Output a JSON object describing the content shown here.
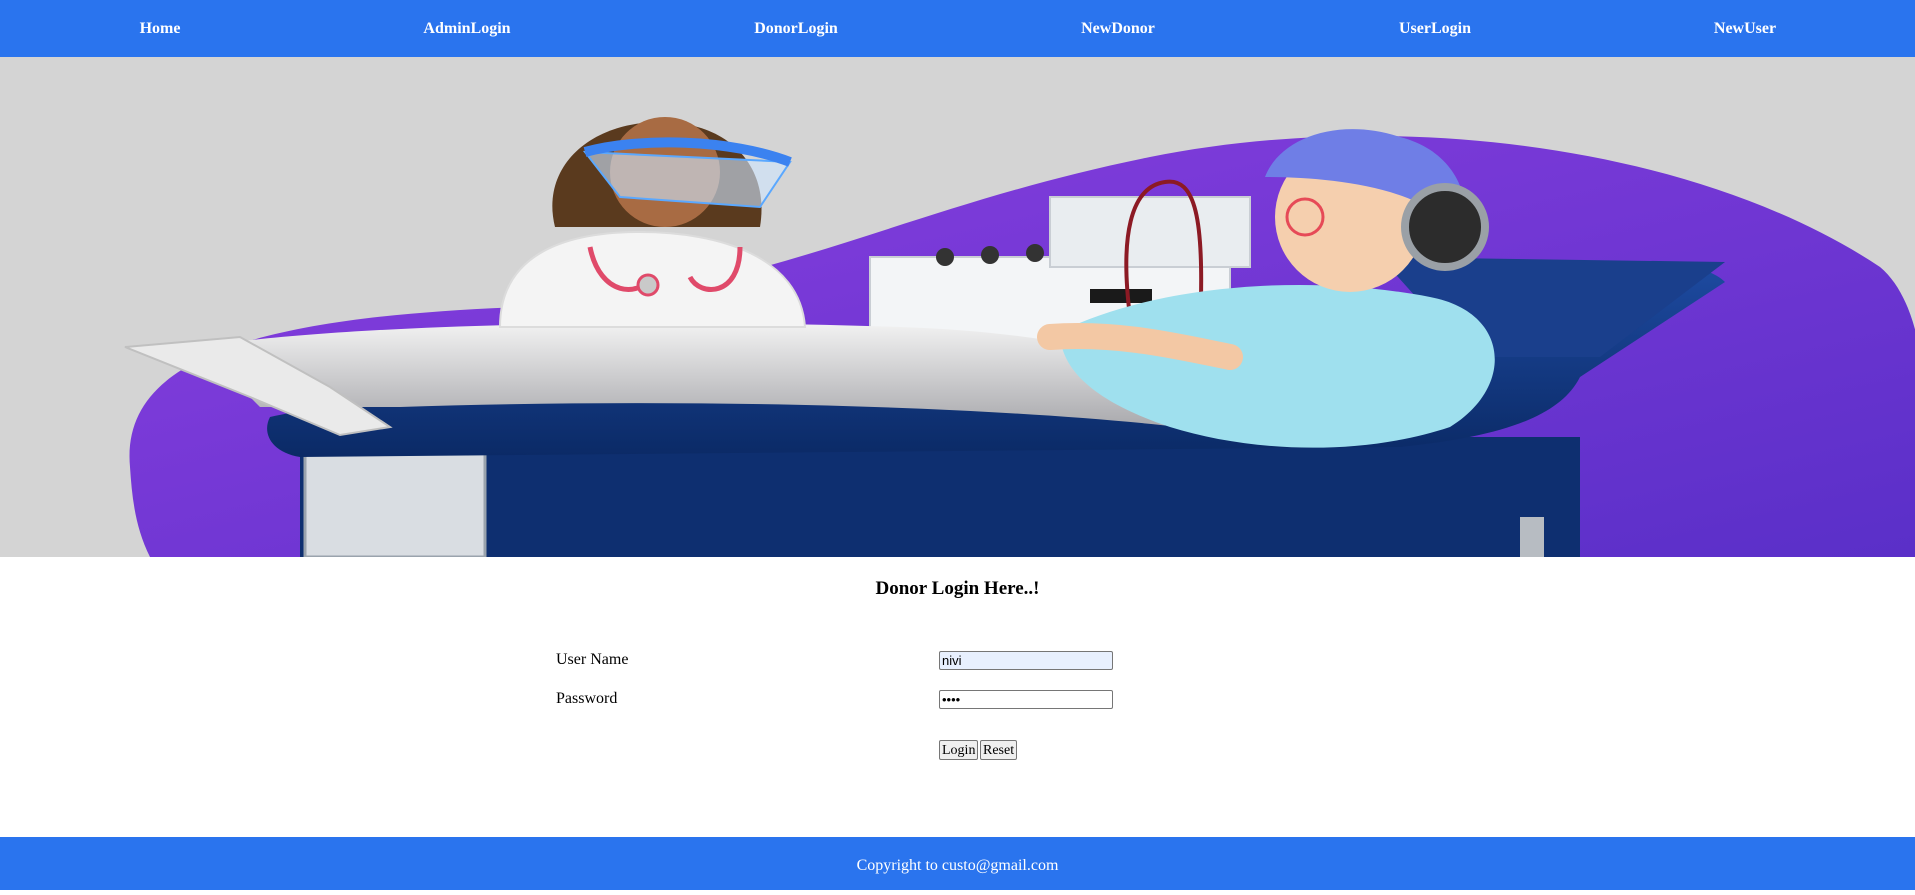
{
  "nav": {
    "items": [
      {
        "label": "Home"
      },
      {
        "label": "AdminLogin"
      },
      {
        "label": "DonorLogin"
      },
      {
        "label": "NewDonor"
      },
      {
        "label": "UserLogin"
      },
      {
        "label": "NewUser"
      }
    ]
  },
  "form": {
    "title": "Donor Login Here..!",
    "username_label": "User Name",
    "username_value": "nivi",
    "password_label": "Password",
    "password_value": "••••",
    "login_button": "Login",
    "reset_button": "Reset"
  },
  "footer": {
    "text": "Copyright to custo@gmail.com"
  },
  "colors": {
    "brand_blue": "#2a74ee",
    "hero_background": "#d4d4d4",
    "hero_blob": "#7b35d8"
  }
}
